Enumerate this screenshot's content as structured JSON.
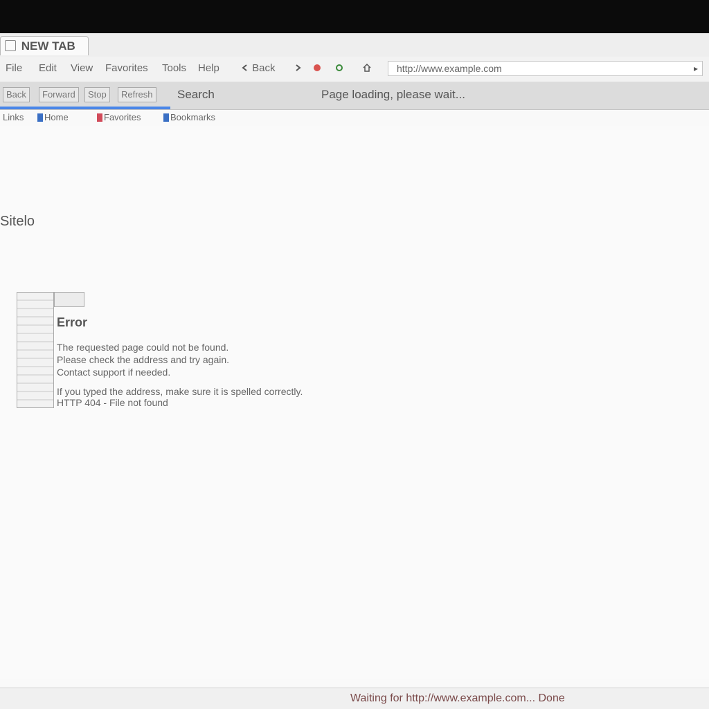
{
  "window": {
    "tab_title": "NEW TAB",
    "address": "http://www.example.com"
  },
  "toolbar": {
    "items": [
      {
        "label": "File"
      },
      {
        "label": "Edit"
      },
      {
        "label": "View"
      },
      {
        "label": "Favorites"
      },
      {
        "label": "Tools"
      },
      {
        "label": "Help"
      }
    ],
    "tools": [
      {
        "label": "Back"
      },
      {
        "label": "Forward"
      },
      {
        "label": "Stop"
      },
      {
        "label": "Refresh"
      },
      {
        "label": "Home"
      }
    ]
  },
  "command_bar": {
    "buttons": [
      "Back",
      "Forward",
      "Stop",
      "Refresh"
    ],
    "search_text": "Search",
    "status_text": "Page loading, please wait..."
  },
  "bookmarks": [
    "Links",
    "Home",
    "Favorites",
    "Bookmarks"
  ],
  "page": {
    "heading": "Sitelo",
    "info_title": "Error",
    "info_lines": [
      "The requested page could not be found.",
      "Please check the address and try again.",
      "Contact support if needed.",
      "If you typed the address, make sure it is spelled correctly.",
      "HTTP 404 - File not found"
    ]
  },
  "status": "Waiting for http://www.example.com... Done",
  "colors": {
    "progress": "#4a86e8",
    "status_text": "#7a4a4a"
  }
}
